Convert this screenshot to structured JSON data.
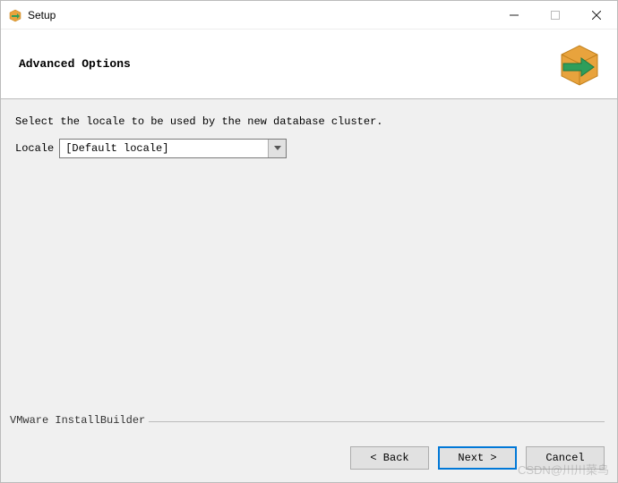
{
  "window": {
    "title": "Setup"
  },
  "header": {
    "title": "Advanced Options"
  },
  "content": {
    "instruction": "Select the locale to be used by the new database cluster.",
    "locale_label": "Locale",
    "locale_value": "[Default locale]"
  },
  "footer": {
    "branding": "VMware InstallBuilder",
    "back_label": "< Back",
    "next_label": "Next >",
    "cancel_label": "Cancel"
  },
  "watermark": "CSDN@川川菜鸟"
}
